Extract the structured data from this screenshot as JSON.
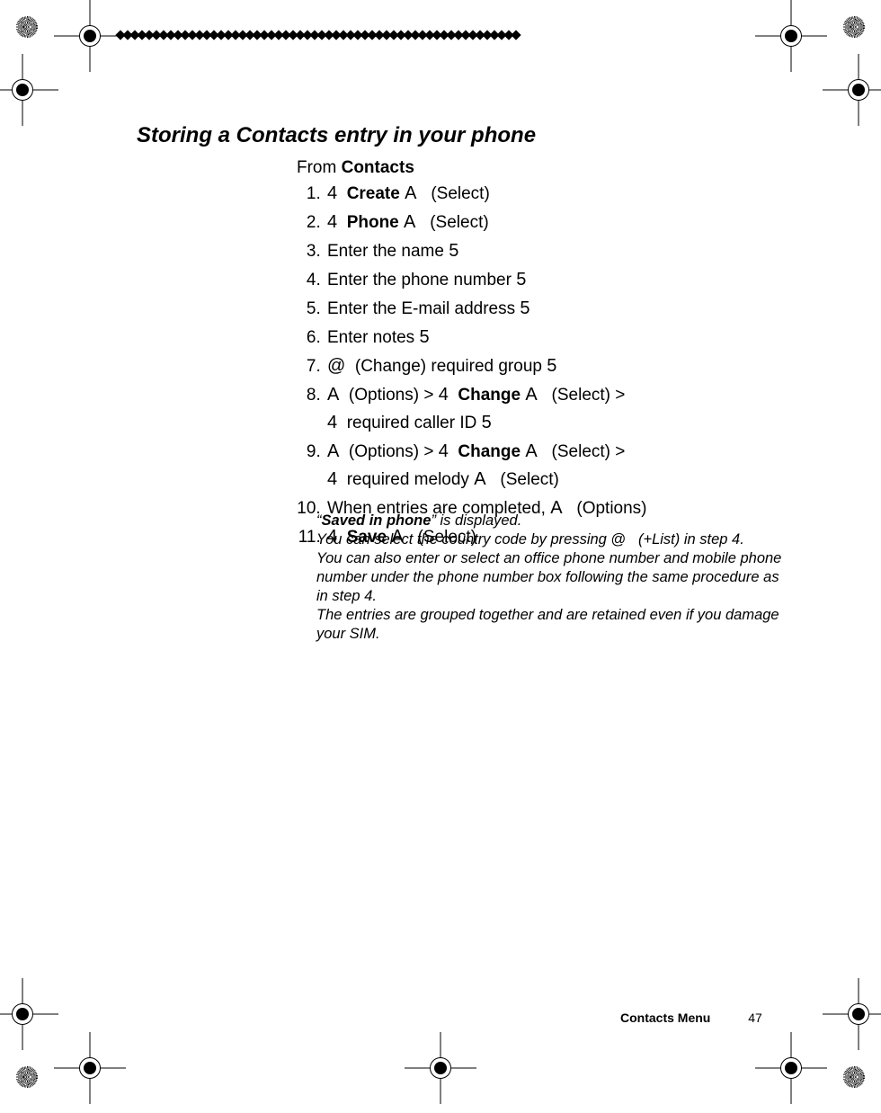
{
  "heading": "Storing a Contacts entry in your phone",
  "from_prefix": "From ",
  "from_target": "Contacts",
  "steps": {
    "s1_sym": "4",
    "s1_b": "Create",
    "s1_sym2": "A",
    "s1_action": "(Select)",
    "s2_sym": "4",
    "s2_b": "Phone",
    "s2_sym2": "A",
    "s2_action": "(Select)",
    "s3_text": "Enter the name ",
    "s3_sym": "5",
    "s4_text": "Enter the phone number ",
    "s4_sym": "5",
    "s5_text": "Enter the E-mail address ",
    "s5_sym": "5",
    "s6_text": "Enter notes ",
    "s6_sym": "5",
    "s7_sym": "@",
    "s7_text": " (Change) required group ",
    "s7_sym2": "5",
    "s8_sym": "A",
    "s8_text1": " (Options) > ",
    "s8_sym2": "4",
    "s8_b": "Change",
    "s8_sym3": "A",
    "s8_text2": " (Select) >",
    "s8_line2_sym": "4",
    "s8_line2_text": " required caller ID ",
    "s8_line2_sym2": "5",
    "s9_sym": "A",
    "s9_text1": " (Options) > ",
    "s9_sym2": "4",
    "s9_b": "Change",
    "s9_sym3": "A",
    "s9_text2": " (Select) >",
    "s9_line2_sym": "4",
    "s9_line2_text": " required melody ",
    "s9_line2_sym2": "A",
    "s9_line2_text2": " (Select)",
    "s10_text": "When entries are completed, ",
    "s10_sym": "A",
    "s10_text2": " (Options)",
    "s11_sym": "4",
    "s11_b": "Save",
    "s11_sym2": "A",
    "s11_action": " (Select)"
  },
  "notes": {
    "n1_q1": "“",
    "n1_b": "Saved in phone",
    "n1_rest": "” is displayed.",
    "n2_a": "You can select the country code by pressing ",
    "n2_sym": "@",
    "n2_b": " (+List) in step 4.",
    "n3": "You can also enter or select an office phone number and mobile phone number under the phone number box following the same procedure as in step 4.",
    "n4": "The entries are grouped together and are retained even if you damage your SIM."
  },
  "footer_label": "Contacts Menu",
  "footer_page": "47"
}
